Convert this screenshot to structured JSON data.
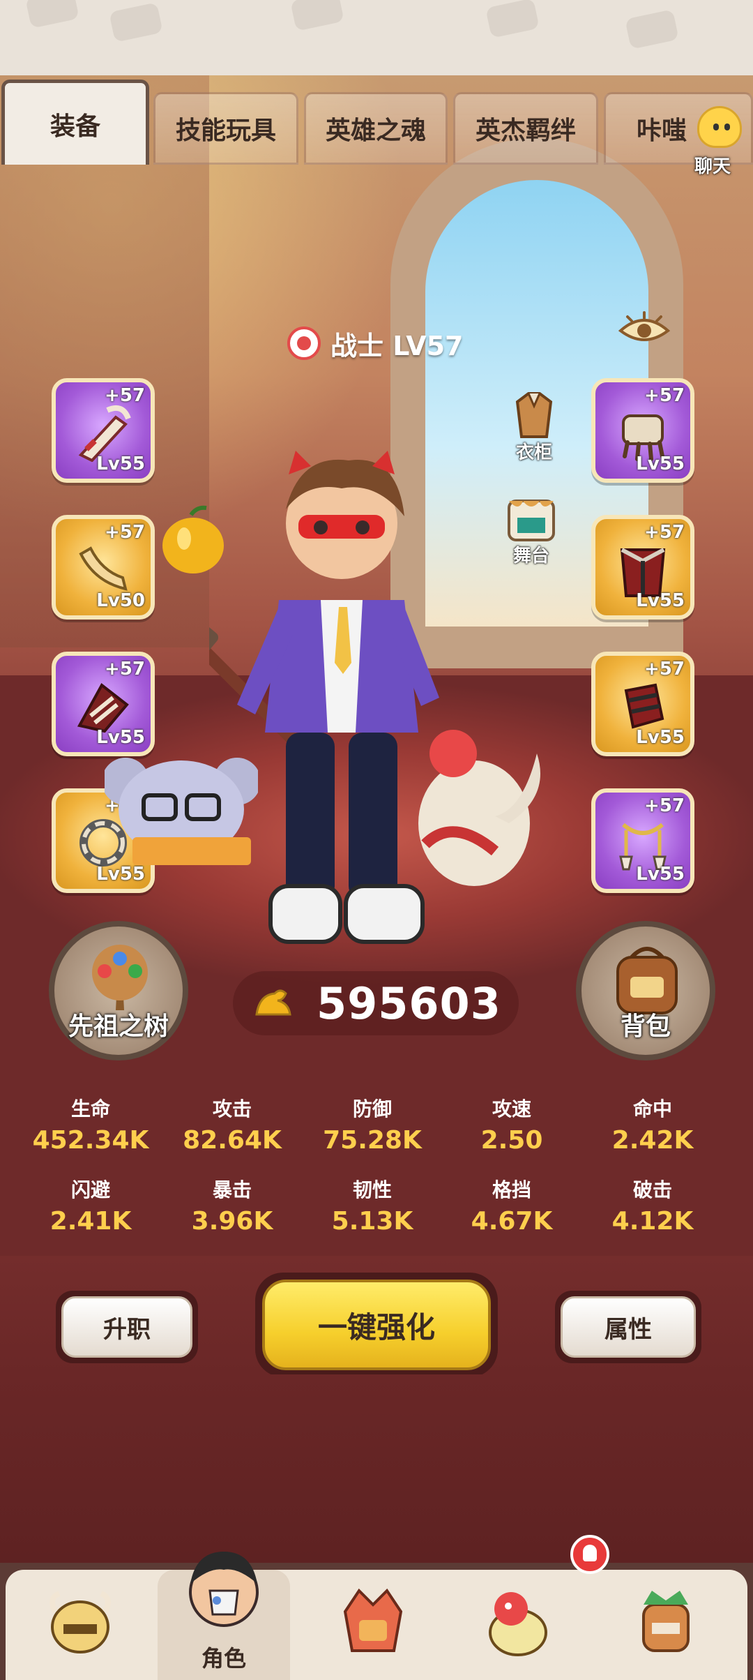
{
  "tabs": [
    "装备",
    "技能玩具",
    "英雄之魂",
    "英杰羁绊",
    "咔嗤"
  ],
  "chat": {
    "label": "聊天"
  },
  "hero": {
    "class_label": "战士 LV57"
  },
  "left_slots": [
    {
      "plus": "+57",
      "lv": "Lv55",
      "color": "purple"
    },
    {
      "plus": "+57",
      "lv": "Lv50",
      "color": "gold"
    },
    {
      "plus": "+57",
      "lv": "Lv55",
      "color": "purple"
    },
    {
      "plus": "+57",
      "lv": "Lv55",
      "color": "gold"
    }
  ],
  "right_slots": [
    {
      "plus": "+57",
      "lv": "Lv55",
      "color": "purple"
    },
    {
      "plus": "+57",
      "lv": "Lv55",
      "color": "gold"
    },
    {
      "plus": "+57",
      "lv": "Lv55",
      "color": "gold"
    },
    {
      "plus": "+57",
      "lv": "Lv55",
      "color": "purple"
    }
  ],
  "side_buttons": {
    "wardrobe": "衣柜",
    "stage": "舞台"
  },
  "round_buttons": {
    "ancestor_tree": "先祖之树",
    "backpack": "背包"
  },
  "power": "595603",
  "stats": [
    {
      "name": "生命",
      "value": "452.34K"
    },
    {
      "name": "攻击",
      "value": "82.64K"
    },
    {
      "name": "防御",
      "value": "75.28K"
    },
    {
      "name": "攻速",
      "value": "2.50"
    },
    {
      "name": "命中",
      "value": "2.42K"
    },
    {
      "name": "闪避",
      "value": "2.41K"
    },
    {
      "name": "暴击",
      "value": "3.96K"
    },
    {
      "name": "韧性",
      "value": "5.13K"
    },
    {
      "name": "格挡",
      "value": "4.67K"
    },
    {
      "name": "破击",
      "value": "4.12K"
    }
  ],
  "actions": {
    "promote": "升职",
    "one_click_enhance": "一键强化",
    "attributes": "属性"
  },
  "nav": {
    "active_label": "角色"
  },
  "colors": {
    "purple_slot": "#a35ad8",
    "gold_slot": "#f0b23c",
    "stat_value": "#ffcf4d",
    "enhance_button": "#f6cf2c"
  }
}
